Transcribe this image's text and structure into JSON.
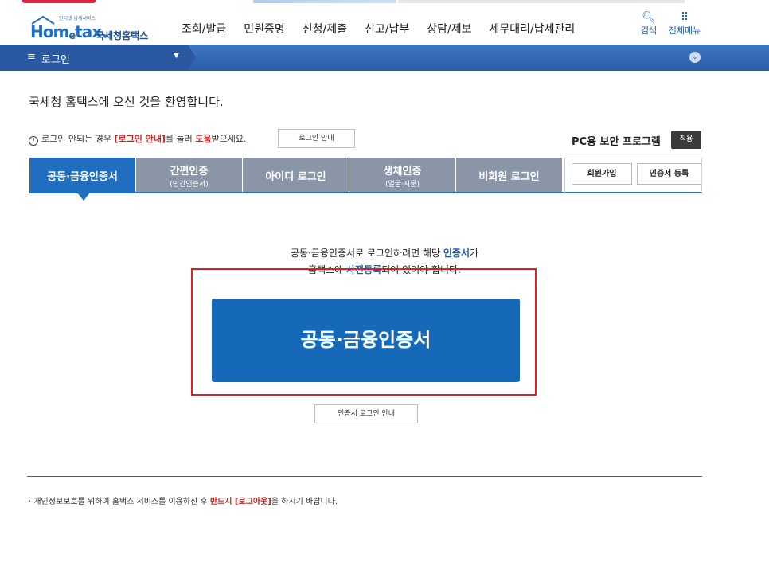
{
  "header": {
    "logo_small": "인터넷 납세서비스",
    "logo_hom": "Hom",
    "logo_e": "e",
    "logo_tax": "tax.",
    "logo_brand": "국세청홈택스",
    "nav": [
      "조회/발급",
      "민원증명",
      "신청/제출",
      "신고/납부",
      "상담/제보",
      "세무대리/납세관리"
    ],
    "search_label": "검색",
    "menu_label": "전체메뉴"
  },
  "breadcrumb": {
    "label": "로그인"
  },
  "welcome": "국세청 홈택스에 오신 것을 환영합니다.",
  "notice": {
    "prefix": "로그인 안되는 경우 ",
    "link": "[로그인 안내]",
    "middle": "를 눌러 ",
    "help": "도움",
    "suffix": "받으세요.",
    "guide_button": "로그인 안내"
  },
  "security": {
    "label": "PC용 보안 프로그램",
    "apply": "적용"
  },
  "tabs": [
    {
      "label": "공동·금융인증서",
      "sub": ""
    },
    {
      "label": "간편인증",
      "sub": "(민간인증서)"
    },
    {
      "label": "아이디 로그인",
      "sub": ""
    },
    {
      "label": "생체인증",
      "sub": "(얼굴·지문)"
    },
    {
      "label": "비회원 로그인",
      "sub": ""
    }
  ],
  "side_buttons": {
    "signup": "회원가입",
    "cert_register": "인증서 등록"
  },
  "main": {
    "line1_a": "공동·금융인증서로 로그인하려면 해당 ",
    "line1_b": "인증서",
    "line1_c": "가",
    "line2_a": "홈택스에 ",
    "line2_b": "사전등록",
    "line2_c": "되어 있어야 합니다.",
    "cert_button": "공동·금융인증서",
    "cert_guide": "인증서 로그인 안내"
  },
  "footnote": {
    "a": "개인정보보호를 위하여 홈택스 서비스를 이용하신 후 ",
    "b": "반드시 [로그아웃]",
    "c": "을 하시기 바랍니다."
  },
  "colors": {
    "primary": "#1668b8",
    "tab_inactive": "#8a96a8",
    "highlight": "#e11d1d"
  }
}
